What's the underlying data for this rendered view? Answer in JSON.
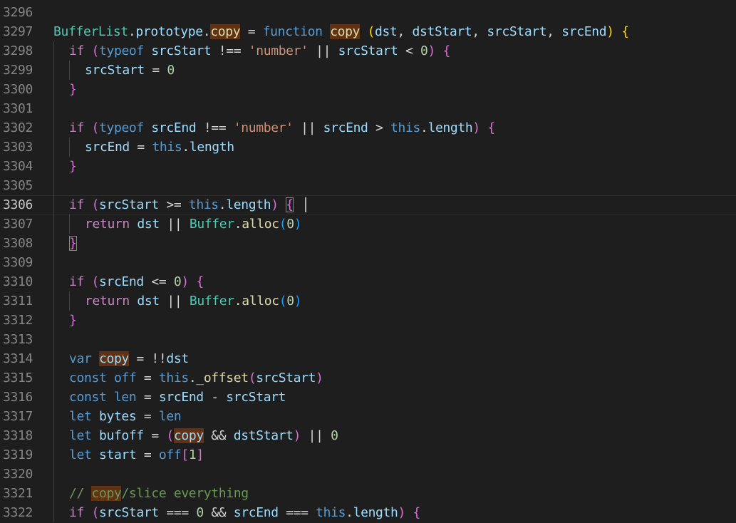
{
  "editor": {
    "highlight_term": "copy",
    "current_line": "3306",
    "colors": {
      "background": "#1e1e1e",
      "keyword": "#569cd6",
      "control": "#c586c0",
      "function": "#dcdcaa",
      "variable": "#9cdcfe",
      "string": "#ce9178",
      "number": "#b5cea8",
      "type": "#4ec9b0",
      "comment": "#6a9955",
      "find_highlight": "#613214"
    },
    "lines": [
      {
        "number": "3296",
        "segments": []
      },
      {
        "number": "3297",
        "segments": [
          {
            "text": "BufferList",
            "cls": "t"
          },
          {
            "text": ".",
            "cls": "p"
          },
          {
            "text": "prototype",
            "cls": "v"
          },
          {
            "text": ".",
            "cls": "p"
          },
          {
            "text": "copy",
            "cls": "f hl"
          },
          {
            "text": " = ",
            "cls": "p"
          },
          {
            "text": "function",
            "cls": "k"
          },
          {
            "text": " ",
            "cls": "p"
          },
          {
            "text": "copy",
            "cls": "f hl"
          },
          {
            "text": " ",
            "cls": "p"
          },
          {
            "text": "(",
            "cls": "b1"
          },
          {
            "text": "dst",
            "cls": "v"
          },
          {
            "text": ", ",
            "cls": "p"
          },
          {
            "text": "dstStart",
            "cls": "v"
          },
          {
            "text": ", ",
            "cls": "p"
          },
          {
            "text": "srcStart",
            "cls": "v"
          },
          {
            "text": ", ",
            "cls": "p"
          },
          {
            "text": "srcEnd",
            "cls": "v"
          },
          {
            "text": ")",
            "cls": "b1"
          },
          {
            "text": " ",
            "cls": "p"
          },
          {
            "text": "{",
            "cls": "b1"
          }
        ]
      },
      {
        "number": "3298",
        "indent": 1,
        "segments": [
          {
            "text": "if",
            "cls": "c"
          },
          {
            "text": " ",
            "cls": "p"
          },
          {
            "text": "(",
            "cls": "b2"
          },
          {
            "text": "typeof",
            "cls": "k"
          },
          {
            "text": " ",
            "cls": "p"
          },
          {
            "text": "srcStart",
            "cls": "v"
          },
          {
            "text": " !== ",
            "cls": "p"
          },
          {
            "text": "'number'",
            "cls": "s"
          },
          {
            "text": " || ",
            "cls": "p"
          },
          {
            "text": "srcStart",
            "cls": "v"
          },
          {
            "text": " < ",
            "cls": "p"
          },
          {
            "text": "0",
            "cls": "n"
          },
          {
            "text": ")",
            "cls": "b2"
          },
          {
            "text": " ",
            "cls": "p"
          },
          {
            "text": "{",
            "cls": "b2"
          }
        ]
      },
      {
        "number": "3299",
        "indent": 2,
        "segments": [
          {
            "text": "srcStart",
            "cls": "v"
          },
          {
            "text": " = ",
            "cls": "p"
          },
          {
            "text": "0",
            "cls": "n"
          }
        ]
      },
      {
        "number": "3300",
        "indent": 1,
        "segments": [
          {
            "text": "}",
            "cls": "b2"
          }
        ]
      },
      {
        "number": "3301",
        "indent": 1,
        "segments": []
      },
      {
        "number": "3302",
        "indent": 1,
        "segments": [
          {
            "text": "if",
            "cls": "c"
          },
          {
            "text": " ",
            "cls": "p"
          },
          {
            "text": "(",
            "cls": "b2"
          },
          {
            "text": "typeof",
            "cls": "k"
          },
          {
            "text": " ",
            "cls": "p"
          },
          {
            "text": "srcEnd",
            "cls": "v"
          },
          {
            "text": " !== ",
            "cls": "p"
          },
          {
            "text": "'number'",
            "cls": "s"
          },
          {
            "text": " || ",
            "cls": "p"
          },
          {
            "text": "srcEnd",
            "cls": "v"
          },
          {
            "text": " > ",
            "cls": "p"
          },
          {
            "text": "this",
            "cls": "k"
          },
          {
            "text": ".",
            "cls": "p"
          },
          {
            "text": "length",
            "cls": "v"
          },
          {
            "text": ")",
            "cls": "b2"
          },
          {
            "text": " ",
            "cls": "p"
          },
          {
            "text": "{",
            "cls": "b2"
          }
        ]
      },
      {
        "number": "3303",
        "indent": 2,
        "segments": [
          {
            "text": "srcEnd",
            "cls": "v"
          },
          {
            "text": " = ",
            "cls": "p"
          },
          {
            "text": "this",
            "cls": "k"
          },
          {
            "text": ".",
            "cls": "p"
          },
          {
            "text": "length",
            "cls": "v"
          }
        ]
      },
      {
        "number": "3304",
        "indent": 1,
        "segments": [
          {
            "text": "}",
            "cls": "b2"
          }
        ]
      },
      {
        "number": "3305",
        "indent": 1,
        "segments": []
      },
      {
        "number": "3306",
        "indent": 1,
        "current": true,
        "segments": [
          {
            "text": "if",
            "cls": "c"
          },
          {
            "text": " ",
            "cls": "p"
          },
          {
            "text": "(",
            "cls": "b2"
          },
          {
            "text": "srcStart",
            "cls": "v"
          },
          {
            "text": " >= ",
            "cls": "p"
          },
          {
            "text": "this",
            "cls": "k"
          },
          {
            "text": ".",
            "cls": "p"
          },
          {
            "text": "length",
            "cls": "v"
          },
          {
            "text": ")",
            "cls": "b2"
          },
          {
            "text": " ",
            "cls": "p"
          },
          {
            "text": "{",
            "cls": "b2 bm"
          }
        ]
      },
      {
        "number": "3307",
        "indent": 2,
        "segments": [
          {
            "text": "return",
            "cls": "c"
          },
          {
            "text": " ",
            "cls": "p"
          },
          {
            "text": "dst",
            "cls": "v"
          },
          {
            "text": " || ",
            "cls": "p"
          },
          {
            "text": "Buffer",
            "cls": "t"
          },
          {
            "text": ".",
            "cls": "p"
          },
          {
            "text": "alloc",
            "cls": "f"
          },
          {
            "text": "(",
            "cls": "b3"
          },
          {
            "text": "0",
            "cls": "n"
          },
          {
            "text": ")",
            "cls": "b3"
          }
        ]
      },
      {
        "number": "3308",
        "indent": 1,
        "segments": [
          {
            "text": "}",
            "cls": "b2 bm"
          }
        ]
      },
      {
        "number": "3309",
        "indent": 1,
        "segments": []
      },
      {
        "number": "3310",
        "indent": 1,
        "segments": [
          {
            "text": "if",
            "cls": "c"
          },
          {
            "text": " ",
            "cls": "p"
          },
          {
            "text": "(",
            "cls": "b2"
          },
          {
            "text": "srcEnd",
            "cls": "v"
          },
          {
            "text": " <= ",
            "cls": "p"
          },
          {
            "text": "0",
            "cls": "n"
          },
          {
            "text": ")",
            "cls": "b2"
          },
          {
            "text": " ",
            "cls": "p"
          },
          {
            "text": "{",
            "cls": "b2"
          }
        ]
      },
      {
        "number": "3311",
        "indent": 2,
        "segments": [
          {
            "text": "return",
            "cls": "c"
          },
          {
            "text": " ",
            "cls": "p"
          },
          {
            "text": "dst",
            "cls": "v"
          },
          {
            "text": " || ",
            "cls": "p"
          },
          {
            "text": "Buffer",
            "cls": "t"
          },
          {
            "text": ".",
            "cls": "p"
          },
          {
            "text": "alloc",
            "cls": "f"
          },
          {
            "text": "(",
            "cls": "b3"
          },
          {
            "text": "0",
            "cls": "n"
          },
          {
            "text": ")",
            "cls": "b3"
          }
        ]
      },
      {
        "number": "3312",
        "indent": 1,
        "segments": [
          {
            "text": "}",
            "cls": "b2"
          }
        ]
      },
      {
        "number": "3313",
        "indent": 1,
        "segments": []
      },
      {
        "number": "3314",
        "indent": 1,
        "segments": [
          {
            "text": "var",
            "cls": "k"
          },
          {
            "text": " ",
            "cls": "p"
          },
          {
            "text": "copy",
            "cls": "v hl"
          },
          {
            "text": " = !!",
            "cls": "p"
          },
          {
            "text": "dst",
            "cls": "v"
          }
        ]
      },
      {
        "number": "3315",
        "indent": 1,
        "segments": [
          {
            "text": "const",
            "cls": "k"
          },
          {
            "text": " ",
            "cls": "p"
          },
          {
            "text": "off",
            "cls": "k"
          },
          {
            "text": " = ",
            "cls": "p"
          },
          {
            "text": "this",
            "cls": "k"
          },
          {
            "text": ".",
            "cls": "p"
          },
          {
            "text": "_offset",
            "cls": "f"
          },
          {
            "text": "(",
            "cls": "b2"
          },
          {
            "text": "srcStart",
            "cls": "v"
          },
          {
            "text": ")",
            "cls": "b2"
          }
        ]
      },
      {
        "number": "3316",
        "indent": 1,
        "segments": [
          {
            "text": "const",
            "cls": "k"
          },
          {
            "text": " ",
            "cls": "p"
          },
          {
            "text": "len",
            "cls": "k"
          },
          {
            "text": " = ",
            "cls": "p"
          },
          {
            "text": "srcEnd",
            "cls": "v"
          },
          {
            "text": " - ",
            "cls": "p"
          },
          {
            "text": "srcStart",
            "cls": "v"
          }
        ]
      },
      {
        "number": "3317",
        "indent": 1,
        "segments": [
          {
            "text": "let",
            "cls": "k"
          },
          {
            "text": " ",
            "cls": "p"
          },
          {
            "text": "bytes",
            "cls": "v"
          },
          {
            "text": " = ",
            "cls": "p"
          },
          {
            "text": "len",
            "cls": "k"
          }
        ]
      },
      {
        "number": "3318",
        "indent": 1,
        "segments": [
          {
            "text": "let",
            "cls": "k"
          },
          {
            "text": " ",
            "cls": "p"
          },
          {
            "text": "bufoff",
            "cls": "v"
          },
          {
            "text": " = ",
            "cls": "p"
          },
          {
            "text": "(",
            "cls": "b2"
          },
          {
            "text": "copy",
            "cls": "v hl"
          },
          {
            "text": " && ",
            "cls": "p"
          },
          {
            "text": "dstStart",
            "cls": "v"
          },
          {
            "text": ")",
            "cls": "b2"
          },
          {
            "text": " || ",
            "cls": "p"
          },
          {
            "text": "0",
            "cls": "n"
          }
        ]
      },
      {
        "number": "3319",
        "indent": 1,
        "segments": [
          {
            "text": "let",
            "cls": "k"
          },
          {
            "text": " ",
            "cls": "p"
          },
          {
            "text": "start",
            "cls": "v"
          },
          {
            "text": " = ",
            "cls": "p"
          },
          {
            "text": "off",
            "cls": "k"
          },
          {
            "text": "[",
            "cls": "b2"
          },
          {
            "text": "1",
            "cls": "n"
          },
          {
            "text": "]",
            "cls": "b2"
          }
        ]
      },
      {
        "number": "3320",
        "indent": 1,
        "segments": []
      },
      {
        "number": "3321",
        "indent": 1,
        "segments": [
          {
            "text": "// ",
            "cls": "cm"
          },
          {
            "text": "copy",
            "cls": "cm hl"
          },
          {
            "text": "/slice everything",
            "cls": "cm"
          }
        ]
      },
      {
        "number": "3322",
        "indent": 1,
        "segments": [
          {
            "text": "if",
            "cls": "c"
          },
          {
            "text": " ",
            "cls": "p"
          },
          {
            "text": "(",
            "cls": "b2"
          },
          {
            "text": "srcStart",
            "cls": "v"
          },
          {
            "text": " === ",
            "cls": "p"
          },
          {
            "text": "0",
            "cls": "n"
          },
          {
            "text": " && ",
            "cls": "p"
          },
          {
            "text": "srcEnd",
            "cls": "v"
          },
          {
            "text": " === ",
            "cls": "p"
          },
          {
            "text": "this",
            "cls": "k"
          },
          {
            "text": ".",
            "cls": "p"
          },
          {
            "text": "length",
            "cls": "v"
          },
          {
            "text": ")",
            "cls": "b2"
          },
          {
            "text": " ",
            "cls": "p"
          },
          {
            "text": "{",
            "cls": "b2"
          }
        ]
      }
    ]
  }
}
